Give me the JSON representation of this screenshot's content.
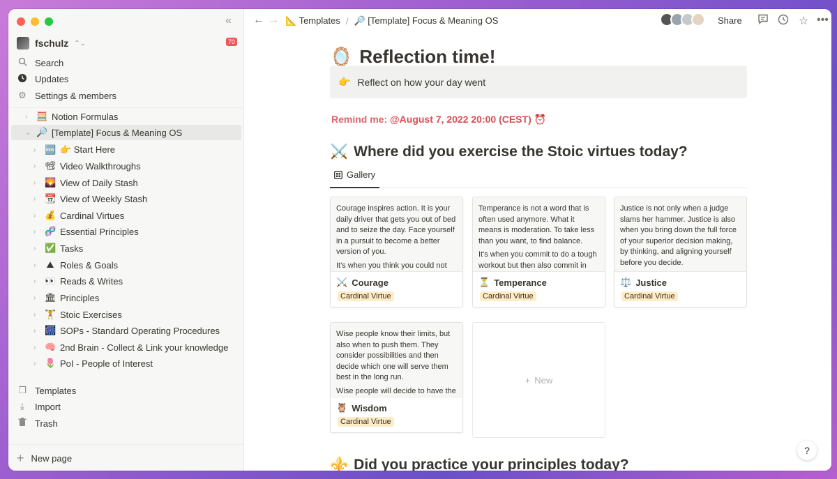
{
  "sidebar": {
    "workspace_name": "fschulz",
    "notifications": "70",
    "menu": [
      {
        "label": "Search"
      },
      {
        "label": "Updates"
      },
      {
        "label": "Settings & members"
      }
    ],
    "tree": [
      {
        "emoji": "🧮",
        "label": "Notion Formulas"
      },
      {
        "emoji": "🔎",
        "label": "[Template] Focus & Meaning OS"
      },
      {
        "emoji": "🆕",
        "label": "👉 Start Here"
      },
      {
        "emoji": "📽",
        "label": "Video Walkthroughs"
      },
      {
        "emoji": "🌄",
        "label": "View of Daily Stash"
      },
      {
        "emoji": "📆",
        "label": "View of Weekly Stash"
      },
      {
        "emoji": "💰",
        "label": "Cardinal Virtues"
      },
      {
        "emoji": "🧬",
        "label": "Essential Principles"
      },
      {
        "emoji": "✅",
        "label": "Tasks"
      },
      {
        "emoji": "⛰",
        "label": "Roles & Goals"
      },
      {
        "emoji": "👀",
        "label": "Reads & Writes"
      },
      {
        "emoji": "🏛",
        "label": "Principles"
      },
      {
        "emoji": "🏋",
        "label": "Stoic Exercises"
      },
      {
        "emoji": "🎆",
        "label": "SOPs - Standard Operating Procedures"
      },
      {
        "emoji": "🧠",
        "label": "2nd Brain - Collect & Link your knowledge"
      },
      {
        "emoji": "🌷",
        "label": "PoI - People of Interest"
      }
    ],
    "footer": [
      {
        "label": "Templates"
      },
      {
        "label": "Import"
      },
      {
        "label": "Trash"
      }
    ],
    "new_page": "New page"
  },
  "topbar": {
    "crumb1_emoji": "📐",
    "crumb1": "Templates",
    "crumb2_emoji": "🔎",
    "crumb2": "[Template] Focus & Meaning OS",
    "share": "Share"
  },
  "page": {
    "title_emoji": "🪞",
    "title": "Reflection time!",
    "callout_emoji": "👉",
    "callout": "Reflect on how your day went",
    "remind_label": "Remind me:",
    "remind_date": "@August 7, 2022 20:00 (CEST)",
    "remind_emoji": "⏰",
    "section1_emoji": "⚔️",
    "section1": "Where did you exercise the Stoic virtues today?",
    "gallery_tab": "Gallery",
    "section2_emoji": "⚜️",
    "section2": "Did you practice your principles today?",
    "new_card": "New"
  },
  "cards": [
    {
      "emoji": "⚔️",
      "title": "Courage",
      "tag": "Cardinal Virtue",
      "p1": "Courage inspires action. It is your daily driver that gets you out of bed and to seize the day. Face yourself in a pursuit to become a better version of you.",
      "p2": "It's when you think you could not"
    },
    {
      "emoji": "⏳",
      "title": "Temperance",
      "tag": "Cardinal Virtue",
      "p1": "Temperance is not a word that is often used anymore. What it means is moderation. To take less than you want, to find balance.",
      "p2": "It's when you commit to do a tough workout but then also commit in the"
    },
    {
      "emoji": "⚖️",
      "title": "Justice",
      "tag": "Cardinal Virtue",
      "p1": "Justice is not only when a judge slams her hammer. Justice is also when you bring down the full force of your superior decision making, by thinking, and aligning yourself before you decide.",
      "p2": ""
    },
    {
      "emoji": "🦉",
      "title": "Wisdom",
      "tag": "Cardinal Virtue",
      "p1": "Wise people know their limits, but also when to push them. They consider possibilities and then decide which one will serve them best in the long run.",
      "p2": "Wise people will decide to have the"
    }
  ]
}
